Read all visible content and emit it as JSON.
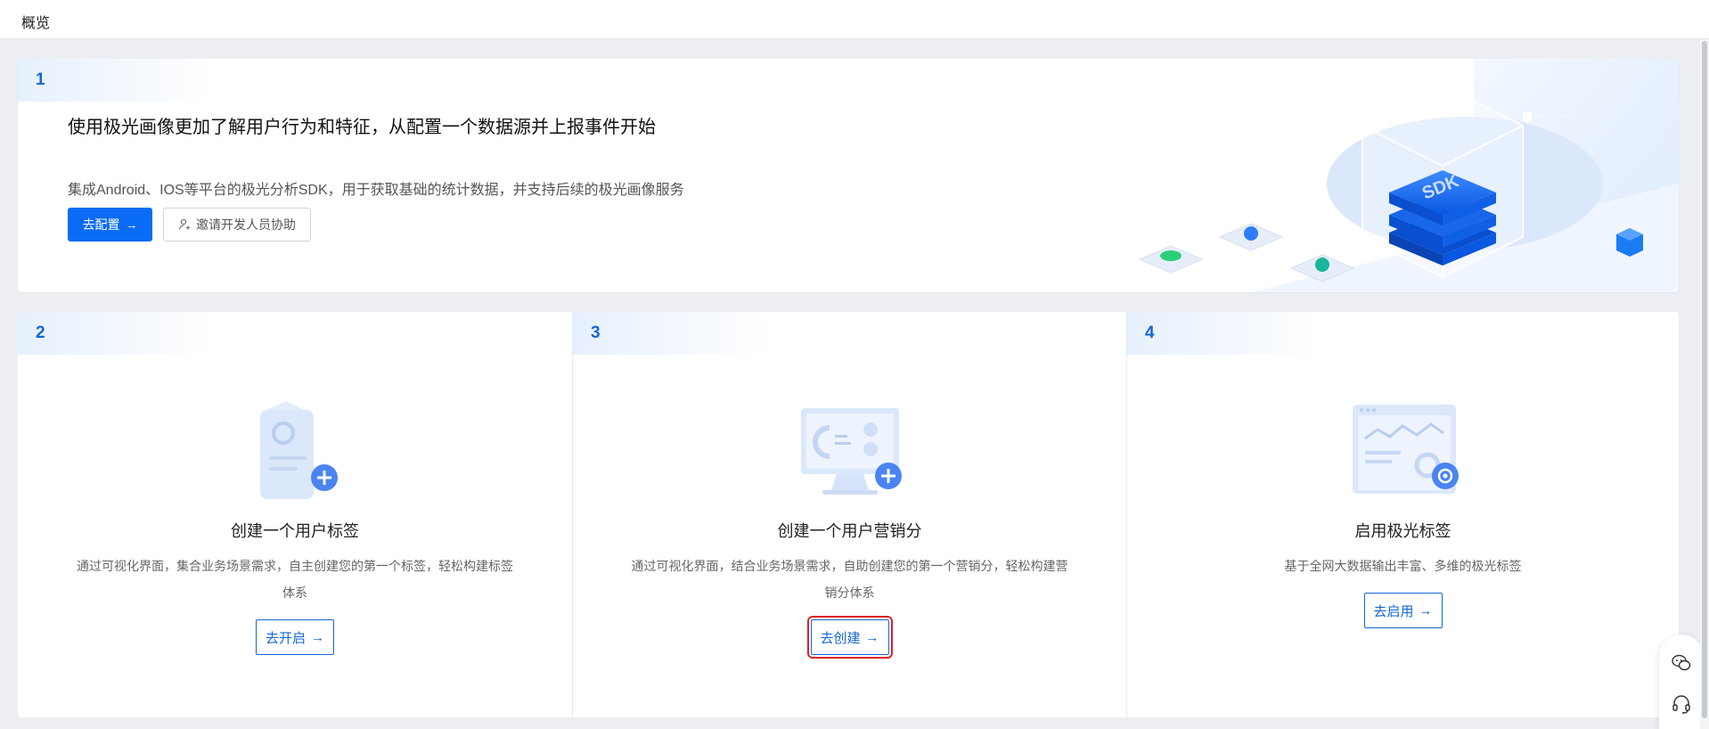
{
  "topbar": {
    "title": "概览"
  },
  "card1": {
    "number": "1",
    "title": "使用极光画像更加了解用户行为和特征，从配置一个数据源并上报事件开始",
    "desc": "集成Android、IOS等平台的极光分析SDK，用于获取基础的统计数据，并支持后续的极光画像服务",
    "primary_button": "去配置",
    "invite_button": "邀请开发人员协助",
    "illustration_label": "SDK"
  },
  "steps": [
    {
      "number": "2",
      "title": "创建一个用户标签",
      "desc": "通过可视化界面，集合业务场景需求，自主创建您的第一个标签，轻松构建标签体系",
      "button": "去开启"
    },
    {
      "number": "3",
      "title": "创建一个用户营销分",
      "desc": "通过可视化界面，结合业务场景需求，自助创建您的第一个营销分，轻松构建营销分体系",
      "button": "去创建"
    },
    {
      "number": "4",
      "title": "启用极光标签",
      "desc": "基于全网大数据输出丰富、多维的极光标签",
      "button": "去启用"
    }
  ],
  "colors": {
    "accent": "#0a6cf5",
    "link": "#1366d6",
    "highlight": "#e02020"
  },
  "icons": {
    "arrow": "→",
    "invite": "user-plus-icon",
    "wechat": "wechat-icon",
    "support": "headset-icon"
  }
}
